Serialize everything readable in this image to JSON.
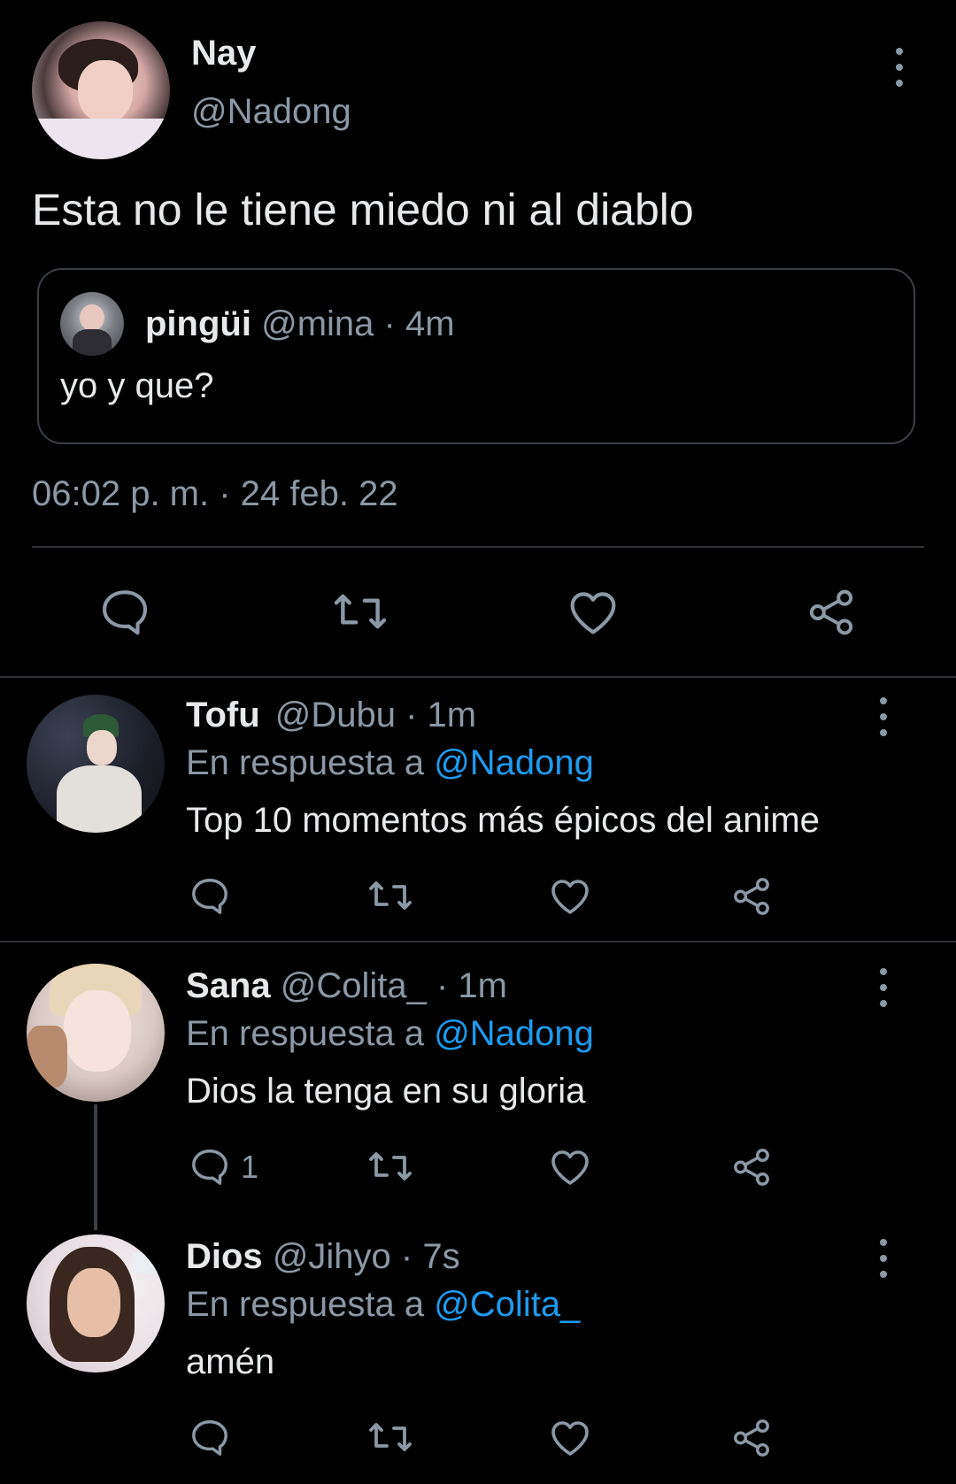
{
  "main_tweet": {
    "name": "Nay",
    "handle": "@Nadong",
    "text": "Esta no le tiene miedo ni al diablo",
    "quote": {
      "name": "pingüi",
      "meta": "@mina · 4m",
      "text": "yo y que?"
    },
    "timestamp": "06:02 p. m. · 24 feb. 22"
  },
  "replies": [
    {
      "name": "Tofu",
      "meta": "@Dubu · 1m",
      "reply_prefix": "En respuesta a",
      "reply_to": "@Nadong",
      "text": "Top 10 momentos más épicos del anime",
      "reply_count": ""
    },
    {
      "name": "Sana",
      "meta": "@Colita_ · 1m",
      "reply_prefix": "En respuesta a",
      "reply_to": "@Nadong",
      "text": "Dios la tenga en su gloria",
      "reply_count": "1"
    },
    {
      "name": "Dios",
      "meta": "@Jihyo · 7s",
      "reply_prefix": "En respuesta a",
      "reply_to": "@Colita_",
      "text": "amén",
      "reply_count": ""
    }
  ],
  "icons": [
    "reply-icon",
    "retweet-icon",
    "like-icon",
    "share-icon",
    "more-icon"
  ],
  "colors": {
    "background": "#000000",
    "text": "#e7e9ea",
    "secondary": "#8b98a5",
    "accent": "#1d9bf0",
    "divider": "#2f3336"
  }
}
